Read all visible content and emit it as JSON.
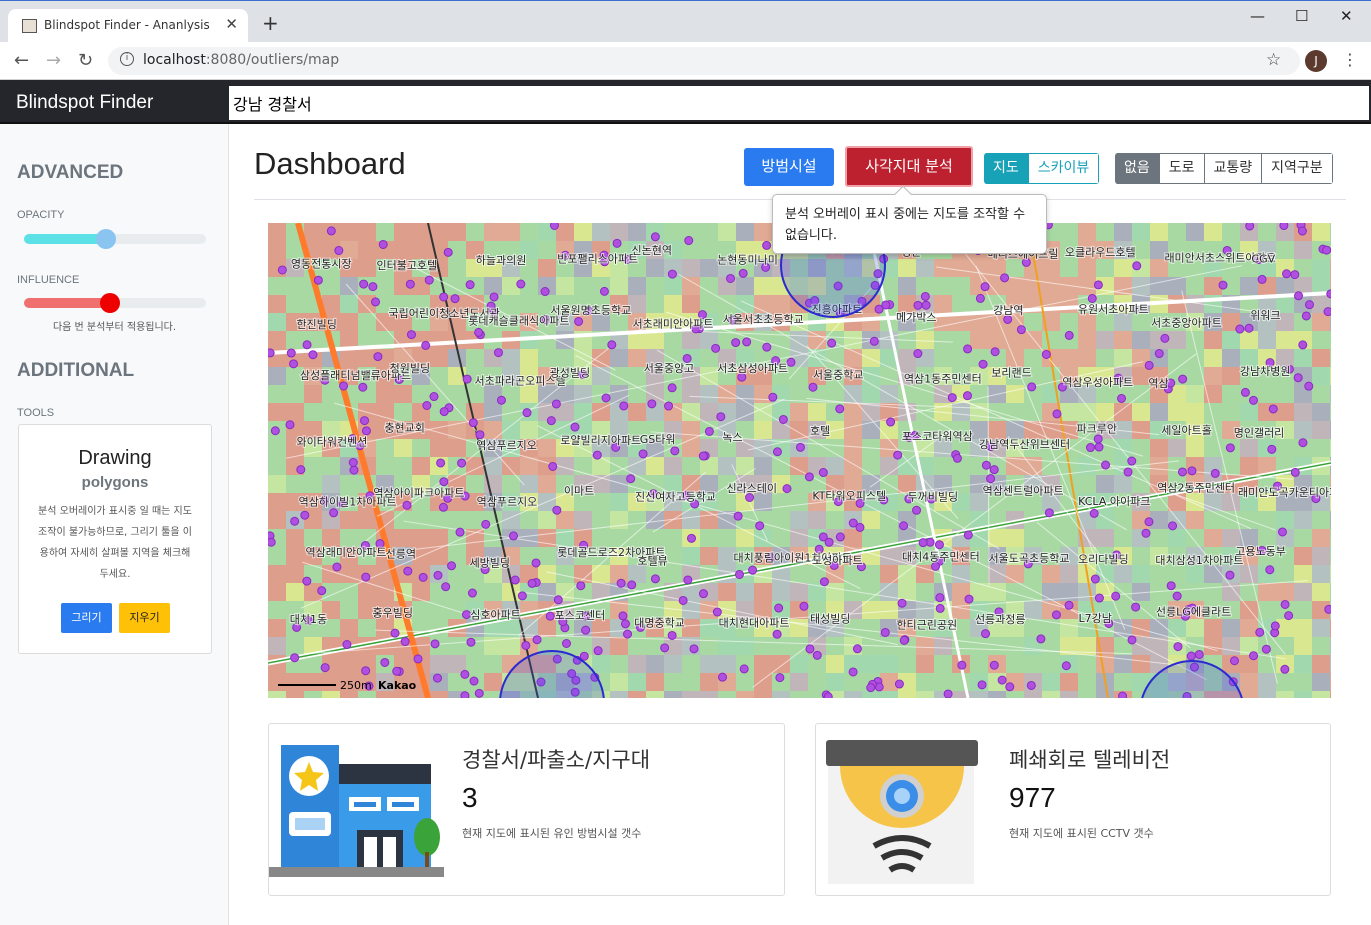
{
  "browser": {
    "tab_title": "Blindspot Finder - Ananlysis",
    "url_host": "localhost",
    "url_rest": ":8080/outliers/map",
    "avatar": "J"
  },
  "header": {
    "brand": "Blindspot Finder",
    "search_value": "강남 경찰서"
  },
  "sidebar": {
    "advanced": "ADVANCED",
    "opacity_label": "OPACITY",
    "opacity_value": 0.45,
    "influence_label": "INFLUENCE",
    "influence_value": 0.47,
    "influence_note": "다음 번 분석부터 적용됩니다.",
    "additional": "ADDITIONAL",
    "tools_label": "TOOLS",
    "drawing_title": "Drawing",
    "drawing_subtitle": "polygons",
    "drawing_desc": "분석 오버레이가 표시중 일 때는 지도 조작이 불가능하므로, 그리기 툴을 이용하여 자세히 살펴볼 지역을 체크해 두세요.",
    "draw_button": "그리기",
    "erase_button": "지우기"
  },
  "main": {
    "title": "Dashboard",
    "facility_button": "방범시설",
    "analyze_button": "사각지대 분석",
    "map_type": [
      "지도",
      "스카이뷰"
    ],
    "overlay": [
      "없음",
      "도로",
      "교통량",
      "지역구분"
    ],
    "tooltip": "분석 오버레이 표시 중에는 지도를 조작할 수 없습니다."
  },
  "map": {
    "scale": "250m",
    "attribution": "Kakao",
    "labels": [
      "영동전통시장",
      "인터불고호텔",
      "하늘과의원",
      "반포팰리스아파트",
      "신논현역",
      "논현동미나미",
      "교보타워",
      "정문",
      "메리츠에이프릴",
      "오클라우드호텔",
      "래미안서초스위트아파트",
      "CGV",
      "한진빌딩",
      "국립어린이청소년도서관",
      "롯데캐슬클래식아파트",
      "서울원명초등학교",
      "서초래미안아파트",
      "서울서초초등학교",
      "진흥아파트",
      "메가박스",
      "강남역",
      "유원서초아파트",
      "서초중앙아파트",
      "위워크",
      "삼성플래티넘밸류아파트",
      "청원빌딩",
      "서초파라곤오피스텔",
      "광성빌딩",
      "서울중앙고",
      "서초삼성아파트",
      "서울중학교",
      "역삼1동주민센터",
      "보리랜드",
      "역삼우성아파트",
      "역삼",
      "강남차병원",
      "와이타워컨벤션",
      "충현교회",
      "역삼푸르지오",
      "로얄빌리지아파트",
      "GS타워",
      "녹스",
      "호텔",
      "포스코타워역삼",
      "강남역두산위브센터",
      "파크루안",
      "세일아트홀",
      "명인갤러리",
      "역삼하이빌1차아파트",
      "역삼아이파크아파트",
      "역삼푸르지오",
      "이마트",
      "진선여자고등학교",
      "신라스테이",
      "KT타워오피스텔",
      "두꺼비빌딩",
      "역삼센트럴아파트",
      "KCLA 아이파크",
      "역삼2동주민센터",
      "래미안도곡카운티아파트",
      "역삼래미안아파트",
      "선릉역",
      "세방빌딩",
      "롯데골드로즈2차아파트",
      "호텔뷰",
      "대치풍림아이원1차아파트",
      "도성아파트",
      "대치4동주민센터",
      "서울도곡초등학교",
      "오리다빌딩",
      "대치삼성1차아파트",
      "고용노동부",
      "대치1동",
      "홍우빌딩",
      "심호아파트",
      "포스코센터",
      "대명중학교",
      "대치현대아파트",
      "태성빌딩",
      "한티근린공원",
      "선릉과정릉",
      "L7강남",
      "선릉LG에클라트"
    ],
    "circles_count": 4
  },
  "stats": [
    {
      "label": "경찰서/파출소/지구대",
      "value": "3",
      "desc": "현재 지도에 표시된 유인 방범시설 갯수"
    },
    {
      "label": "폐쇄회로 텔레비전",
      "value": "977",
      "desc": "현재 지도에 표시된 CCTV 갯수"
    }
  ],
  "colors": {
    "primary": "#2b7bf0",
    "danger": "#bd2130",
    "info": "#17a2b8",
    "secondary": "#6c757d",
    "warning": "#ffc107",
    "opacity_fill": "#5ce1e6",
    "influence_fill": "#f07070",
    "influence_knob": "#ee0000",
    "opacity_knob": "#8ac4f0"
  }
}
